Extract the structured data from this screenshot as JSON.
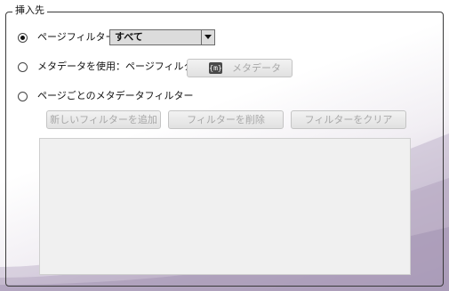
{
  "group": {
    "title": "挿入先"
  },
  "options": {
    "page_filter": {
      "label": "ページフィルター",
      "selected": true,
      "dropdown_value": "すべて"
    },
    "use_metadata": {
      "label": "メタデータを使用：ページフィルター",
      "selected": false,
      "metadata_button_label": "メタデータ",
      "metadata_icon_text": "{m}"
    },
    "per_page_metadata": {
      "label": "ページごとのメタデータフィルター",
      "selected": false
    }
  },
  "filter_buttons": {
    "add_label": "新しいフィルターを追加",
    "delete_label": "フィルターを削除",
    "clear_label": "フィルターをクリア"
  },
  "icons": {
    "dropdown_arrow": "chevron-down-icon",
    "metadata": "metadata-icon"
  },
  "colors": {
    "disabled_text": "#a8a8a8",
    "background_accent": "#c9bfd1"
  }
}
